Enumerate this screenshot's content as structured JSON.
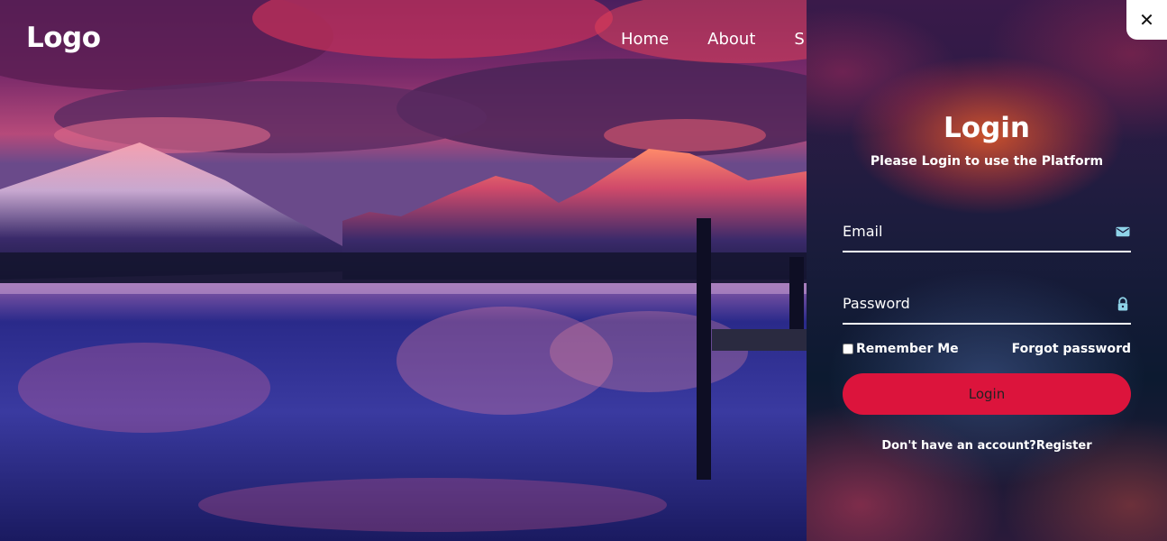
{
  "header": {
    "logo": "Logo",
    "nav": [
      {
        "label": "Home"
      },
      {
        "label": "About"
      },
      {
        "label": "S"
      }
    ]
  },
  "login": {
    "close_glyph": "✕",
    "title": "Login",
    "subtitle": "Please Login to use the Platform",
    "email_label": "Email",
    "email_icon": "mail-icon",
    "password_label": "Password",
    "password_icon": "lock-icon",
    "remember_label": "Remember Me",
    "forgot_label": "Forgot password",
    "button_label": "Login",
    "register_prompt": "Don't have an account?",
    "register_link": "Register"
  },
  "colors": {
    "accent": "#dc143c",
    "icon": "#8fd3e8",
    "text": "#ffffff"
  }
}
